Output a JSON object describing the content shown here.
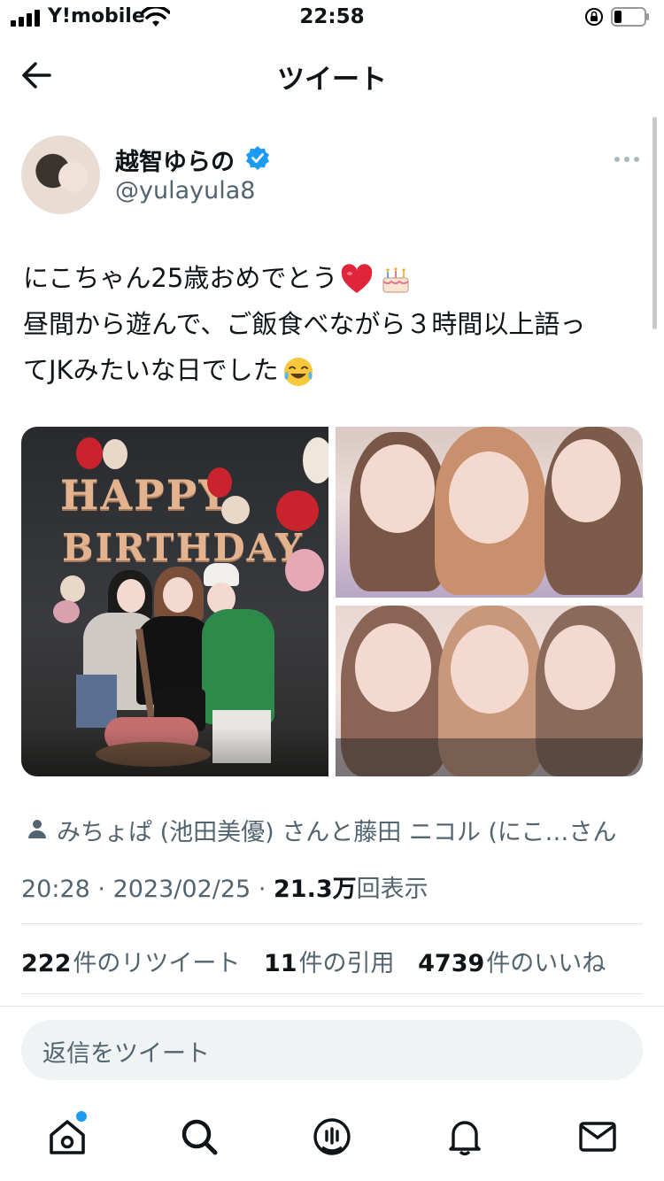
{
  "status_bar": {
    "carrier": "Y!mobile",
    "time": "22:58"
  },
  "nav": {
    "title": "ツイート"
  },
  "author": {
    "name": "越智ゆらの",
    "handle": "@yulayula8",
    "verified": true
  },
  "tweet": {
    "lines": [
      "にこちゃん25歳おめでとう",
      "昼間から遊んで、ご飯食べながら３時間以上語っ",
      "てJKみたいな日でした"
    ],
    "emojis": [
      "red-heart-emoji",
      "birthday-cake-emoji",
      "tears-of-joy-emoji"
    ]
  },
  "photos": {
    "photo1_letters_top": "HAPPY",
    "photo1_letters_bottom": "BIRTHDAY"
  },
  "tagged": {
    "text": "みちょぱ (池田美優) さんと藤田 ニコル (にこ…さん"
  },
  "meta": {
    "time": "20:28",
    "date": "2023/02/25",
    "separator": "·",
    "views_count": "21.3万",
    "views_label": "回表示"
  },
  "stats": {
    "retweets_count": "222",
    "retweets_label": "件のリツイート",
    "quotes_count": "11",
    "quotes_label": "件の引用",
    "likes_count": "4739",
    "likes_label": "件のいいね"
  },
  "reply": {
    "placeholder": "返信をツイート"
  },
  "colors": {
    "accent": "#1d9bf0",
    "text_primary": "#0f1419",
    "text_secondary": "#536471"
  },
  "tab_bar": {
    "items": [
      "home-icon",
      "search-icon",
      "spaces-icon",
      "notifications-icon",
      "messages-icon"
    ]
  }
}
